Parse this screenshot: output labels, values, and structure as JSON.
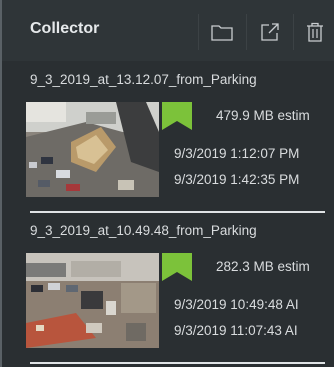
{
  "panel": {
    "title": "Collector",
    "buttons": [
      "folder-icon",
      "export-icon",
      "trash-icon"
    ]
  },
  "recordings": [
    {
      "title": "9_3_2019_at_13.12.07_from_Parking",
      "size": "479.9 MB estim",
      "start_time": "9/3/2019 1:12:07 PM",
      "end_time": "9/3/2019 1:42:35 PM",
      "flag_color": "#7cc23a"
    },
    {
      "title": "9_3_2019_at_10.49.48_from_Parking",
      "size": "282.3 MB estim",
      "start_time": "9/3/2019 10:49:48 AI",
      "end_time": "9/3/2019 11:07:43 AI",
      "flag_color": "#7cc23a"
    }
  ]
}
